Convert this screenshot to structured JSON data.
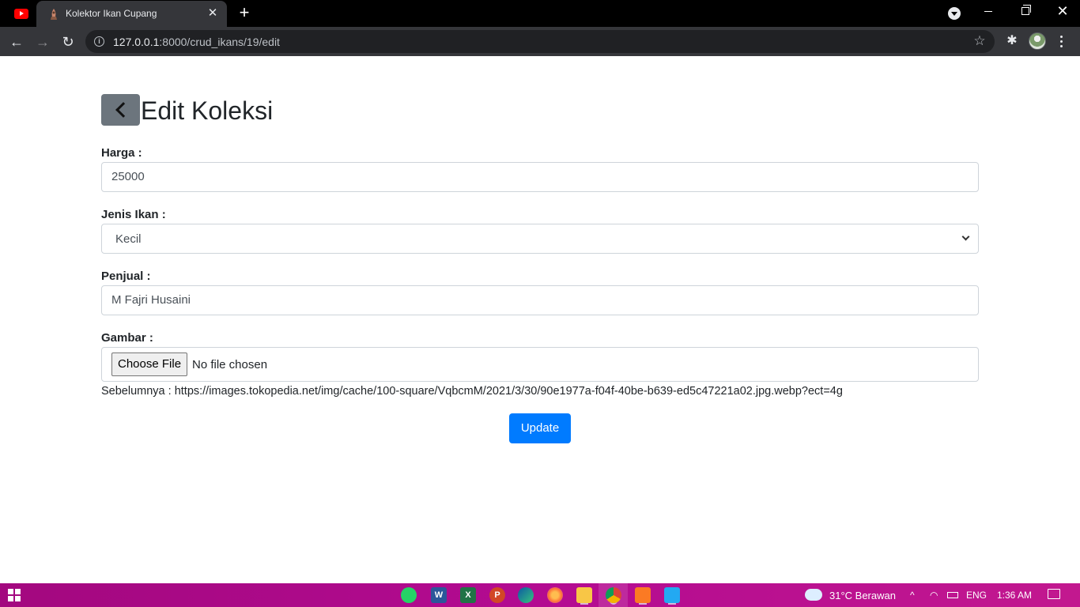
{
  "browser": {
    "tabs": [
      {
        "title": "",
        "icon": "youtube-icon",
        "active": false
      },
      {
        "title": "Kolektor Ikan Cupang",
        "icon": "site-favicon",
        "active": true
      }
    ],
    "tab_close": "✕",
    "new_tab": "+",
    "url_host": "127.0.0.1",
    "url_path": ":8000/crud_ikans/19/edit",
    "window_close": "✕",
    "nav_back": "←",
    "nav_forward": "→",
    "nav_reload": "↻",
    "bookmark_star": "☆",
    "extensions_glyph": "✱"
  },
  "page": {
    "title": "Edit Koleksi",
    "fields": {
      "harga": {
        "label": "Harga :",
        "value": "25000"
      },
      "jenis_ikan": {
        "label": "Jenis Ikan :",
        "value": "Kecil"
      },
      "penjual": {
        "label": "Penjual :",
        "value": "M Fajri Husaini"
      },
      "gambar": {
        "label": "Gambar :",
        "button": "Choose File",
        "status": "No file chosen"
      }
    },
    "previous": "Sebelumnya : https://images.tokopedia.net/img/cache/100-square/VqbcmM/2021/3/30/90e1977a-f04f-40be-b639-ed5c47221a02.jpg.webp?ect=4g",
    "submit": "Update"
  },
  "colors": {
    "primary": "#007bff",
    "secondary": "#6c757d",
    "taskbar": "#b30b91"
  },
  "taskbar": {
    "apps": [
      "whatsapp",
      "word",
      "excel",
      "powerpoint",
      "edge",
      "firefox",
      "file-explorer",
      "chrome",
      "xampp",
      "vscode"
    ],
    "word_letter": "W",
    "excel_letter": "X",
    "ppt_letter": "P",
    "weather": "31°C  Berawan",
    "tray_chevron": "^",
    "language": "ENG",
    "time": "1:36 AM"
  }
}
